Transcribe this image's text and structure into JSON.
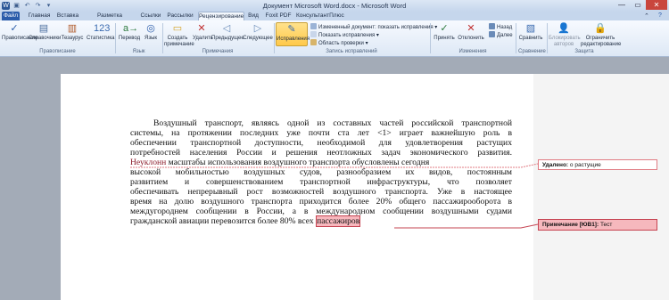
{
  "window": {
    "title": "Документ Microsoft Word.docx - Microsoft Word",
    "controls": {
      "minimize": "—",
      "maximize": "▭",
      "close": "✕"
    }
  },
  "tabs": {
    "file": "Файл",
    "home": "Главная",
    "insert": "Вставка",
    "layout": "Разметка страницы",
    "references": "Ссылки",
    "mailings": "Рассылки",
    "review": "Рецензирование",
    "view": "Вид",
    "foxit": "Foxit PDF",
    "consultant": "КонсультантПлюс"
  },
  "ribbon": {
    "proofing": {
      "spelling": "Правописание",
      "research": "Справочники",
      "thesaurus": "Тезаурус",
      "stats": "Статистика",
      "group": "Правописание"
    },
    "language": {
      "translate": "Перевод",
      "language": "Язык",
      "group": "Язык"
    },
    "comments": {
      "new": "Создать примечание",
      "delete": "Удалить",
      "prev": "Предыдущее",
      "next": "Следующее",
      "group": "Примечания"
    },
    "tracking": {
      "track": "Исправления",
      "display_mode": "Измененный документ: показать исправления",
      "show_markup": "Показать исправления",
      "reviewing_pane": "Область проверки",
      "group": "Запись исправлений"
    },
    "changes": {
      "accept": "Принять",
      "reject": "Отклонить",
      "prev": "Назад",
      "next": "Далее",
      "group": "Изменения"
    },
    "compare": {
      "compare": "Сравнить",
      "group": "Сравнение"
    },
    "protect": {
      "block": "Блокировать авторов",
      "restrict": "Ограничить редактирование",
      "group": "Защита"
    }
  },
  "document": {
    "lines": [
      "Воздушный транспорт, являясь одной из составных частей российской транспортной",
      "системы, на протяжении последних уже почти ста лет <1> играет важнейшую роль в",
      "обеспечении транспортной доступности, необходимой для удовлетворения растущих",
      "потребностей населения России и решения неотложных задач экономического развития.",
      "высокой мобильностью воздушных судов, разнообразием их видов, постоянным",
      "развитием и совершенствованием транспортной инфраструктуры, что позволяет",
      "обеспечивать непрерывный рост возможностей воздушного транспорта. Уже в настоящее",
      "время на долю воздушного транспорта приходится более 20% общего пассажирооборота в",
      "междугороднем сообщении в России, а в международном сообщении воздушными судами"
    ],
    "line5_deleted": "Неуклонн",
    "line5_rest": " масштабы использования воздушного транспорта обусловлены сегодня",
    "last_line_prefix": "гражданской авиации перевозится более 80% всех ",
    "last_line_highlight": "пассажиров"
  },
  "balloons": {
    "deleted": {
      "label": "Удалено:",
      "text": " о растущие"
    },
    "comment": {
      "label": "Примечание [ЮВ1]:",
      "text": " Тест"
    }
  },
  "colors": {
    "deleted": "#8b1a2a",
    "comment_fill": "#f6b8bd",
    "comment_border": "#c64452",
    "file_tab": "#2a5caa"
  }
}
